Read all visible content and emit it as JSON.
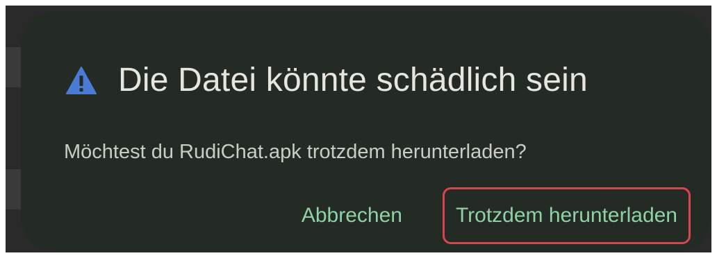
{
  "dialog": {
    "title": "Die Datei könnte schädlich sein",
    "message": "Möchtest du RudiChat.apk trotzdem herunterladen?",
    "icon": "warning-icon",
    "cancel_label": "Abbrechen",
    "download_label": "Trotzdem herunterladen"
  },
  "colors": {
    "dialog_background": "#242b24",
    "title_text": "#e6e6e0",
    "message_text": "#c9cdc6",
    "button_text": "#8fd1a6",
    "warning_icon": "#4a7bd6",
    "highlight_outline": "#d9444e"
  }
}
